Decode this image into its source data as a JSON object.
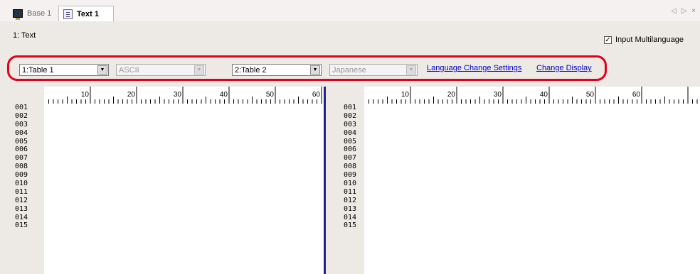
{
  "tabs": [
    {
      "label": "Base 1",
      "icon": "monitor-icon"
    },
    {
      "label": "Text 1",
      "icon": "text-icon"
    }
  ],
  "tab_nav": "◁ ▷ ×",
  "section_title": "1: Text",
  "multilanguage": {
    "label": "Input Multilanguage",
    "checked": true
  },
  "left_table": {
    "value": "1:Table 1"
  },
  "left_encoding": {
    "value": "ASCII"
  },
  "right_table": {
    "value": "2:Table 2"
  },
  "right_encoding": {
    "value": "Japanese"
  },
  "links": {
    "language_change": "Language Change Settings",
    "change_display": "Change Display"
  },
  "ruler_labels": [
    "10",
    "20",
    "30",
    "40",
    "50",
    "60"
  ],
  "line_numbers": [
    "001",
    "002",
    "003",
    "004",
    "005",
    "006",
    "007",
    "008",
    "009",
    "010",
    "011",
    "012",
    "013",
    "014",
    "015"
  ],
  "colors": {
    "highlight": "#e3001b",
    "splitter": "#23238a",
    "link": "#0000cc"
  }
}
